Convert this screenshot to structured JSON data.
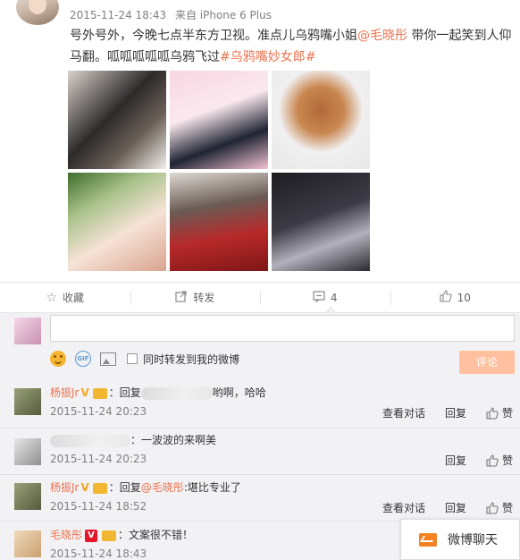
{
  "post": {
    "timestamp": "2015-11-24 18:43",
    "source": "来自 iPhone 6 Plus",
    "text_part1": "号外号外，今晚七点半东方卫视。准点儿乌鸦嘴小姐",
    "mention": "@毛晓彤",
    "text_part2": " 带你一起笑到人仰马翻。呱呱呱呱呱乌鸦飞过",
    "topic": "#乌鸦嘴妙女郎#"
  },
  "actions": {
    "favorite": "收藏",
    "forward": "转发",
    "comment_count": "4",
    "like_count": "10"
  },
  "comment_box": {
    "forward_label": "同时转发到我的微博",
    "submit_label": "评论"
  },
  "comments": [
    {
      "user": "杨振Jr",
      "reply_prefix": "：回复",
      "text": "哟啊，哈哈",
      "time": "2015-11-24 20:23",
      "view_label": "查看对话",
      "reply_label": "回复",
      "like_label": "赞"
    },
    {
      "user": "",
      "text": "：一波波的来啊美",
      "time": "2015-11-24 20:23",
      "reply_label": "回复",
      "like_label": "赞"
    },
    {
      "user": "杨振Jr",
      "reply_prefix": "：回复",
      "mention": "@毛晓彤",
      "text": ":堪比专业了",
      "time": "2015-11-24 18:52",
      "view_label": "查看对话",
      "reply_label": "回复",
      "like_label": "赞"
    },
    {
      "user": "毛晓彤",
      "text": "：文案很不错！",
      "time": "2015-11-24 18:43"
    }
  ],
  "chat_float": {
    "label": "微博聊天"
  },
  "colors": {
    "accent": "#eb7350",
    "submit_bg": "#ffc09f",
    "panel_bg": "#f2f2f5",
    "chat_icon": "#f58220"
  }
}
